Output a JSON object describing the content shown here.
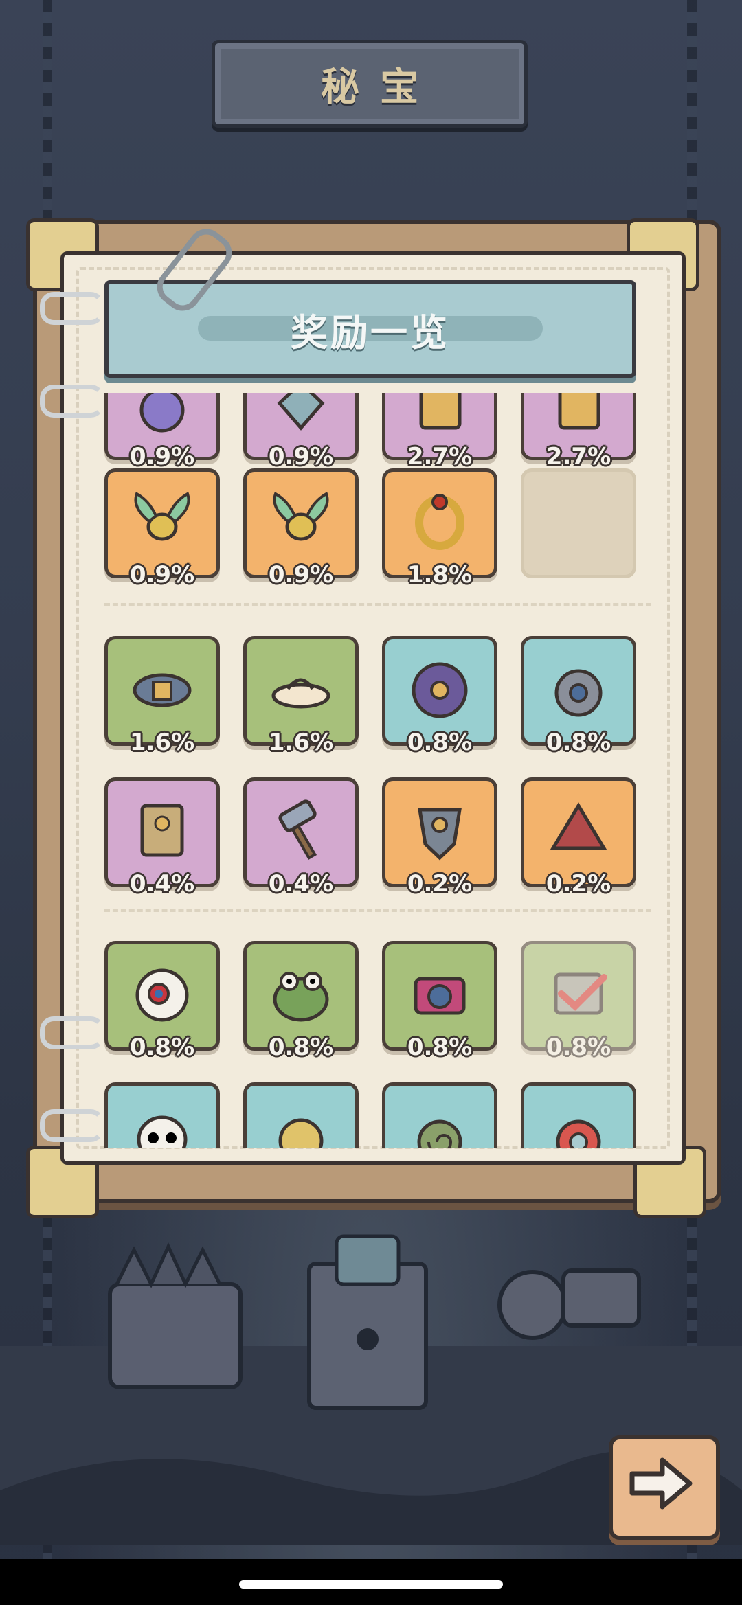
{
  "header": {
    "title": "秘宝"
  },
  "panel": {
    "title": "奖励一览"
  },
  "items": [
    {
      "pct": "0.9%",
      "color": "purple",
      "icon": "jewel-icon"
    },
    {
      "pct": "0.9%",
      "color": "purple",
      "icon": "gem-icon"
    },
    {
      "pct": "2.7%",
      "color": "purple",
      "icon": "card-icon"
    },
    {
      "pct": "2.7%",
      "color": "purple",
      "icon": "card-icon"
    },
    {
      "pct": "0.9%",
      "color": "orange",
      "icon": "winged-ring-icon"
    },
    {
      "pct": "0.9%",
      "color": "orange",
      "icon": "winged-ring-icon"
    },
    {
      "pct": "1.8%",
      "color": "orange",
      "icon": "ring-icon"
    },
    {
      "pct": "",
      "color": "empty",
      "icon": ""
    },
    {
      "pct": "1.6%",
      "color": "green",
      "icon": "bracelet-icon"
    },
    {
      "pct": "1.6%",
      "color": "green",
      "icon": "sandal-icon"
    },
    {
      "pct": "0.8%",
      "color": "teal",
      "icon": "compass-shield-icon"
    },
    {
      "pct": "0.8%",
      "color": "teal",
      "icon": "diving-helmet-icon"
    },
    {
      "pct": "0.4%",
      "color": "purple",
      "icon": "scroll-icon"
    },
    {
      "pct": "0.4%",
      "color": "purple",
      "icon": "hammer-icon"
    },
    {
      "pct": "0.2%",
      "color": "orange",
      "icon": "angel-armor-icon"
    },
    {
      "pct": "0.2%",
      "color": "orange",
      "icon": "cape-icon"
    },
    {
      "pct": "0.8%",
      "color": "green",
      "icon": "eyeball-icon"
    },
    {
      "pct": "0.8%",
      "color": "green",
      "icon": "frog-icon"
    },
    {
      "pct": "0.8%",
      "color": "green",
      "icon": "camera-icon"
    },
    {
      "pct": "0.8%",
      "color": "green",
      "icon": "checked-box-icon",
      "faded": true
    },
    {
      "pct": "",
      "color": "teal",
      "icon": "skull-icon"
    },
    {
      "pct": "",
      "color": "teal",
      "icon": "pufferfish-icon"
    },
    {
      "pct": "",
      "color": "teal",
      "icon": "shell-icon"
    },
    {
      "pct": "",
      "color": "teal",
      "icon": "orb-icon"
    }
  ],
  "colors": {
    "purple": "#d3a9cf",
    "orange": "#f3b36c",
    "green": "#a7c07b",
    "teal": "#98cfd0",
    "empty": "#ded2bb"
  },
  "buttons": {
    "next": "arrow-right-icon"
  }
}
